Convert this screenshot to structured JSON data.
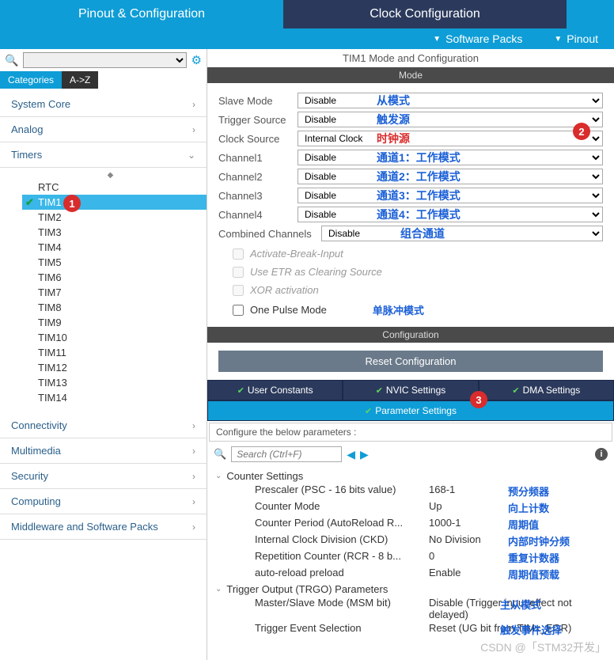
{
  "topTabs": {
    "pinout": "Pinout & Configuration",
    "clock": "Clock Configuration"
  },
  "subBar": {
    "software": "Software Packs",
    "pinout": "Pinout"
  },
  "viewTabs": {
    "categories": "Categories",
    "az": "A->Z"
  },
  "categories": {
    "systemCore": "System Core",
    "analog": "Analog",
    "timers": "Timers",
    "connectivity": "Connectivity",
    "multimedia": "Multimedia",
    "security": "Security",
    "computing": "Computing",
    "middleware": "Middleware and Software Packs"
  },
  "timerItems": [
    "RTC",
    "TIM1",
    "TIM2",
    "TIM3",
    "TIM4",
    "TIM5",
    "TIM6",
    "TIM7",
    "TIM8",
    "TIM9",
    "TIM10",
    "TIM11",
    "TIM12",
    "TIM13",
    "TIM14"
  ],
  "panelTitle": "TIM1 Mode and Configuration",
  "sections": {
    "mode": "Mode",
    "config": "Configuration"
  },
  "mode": {
    "slaveMode": {
      "label": "Slave Mode",
      "value": "Disable",
      "annot": "从模式"
    },
    "triggerSource": {
      "label": "Trigger Source",
      "value": "Disable",
      "annot": "触发源"
    },
    "clockSource": {
      "label": "Clock Source",
      "value": "Internal Clock",
      "annot": "时钟源"
    },
    "channel1": {
      "label": "Channel1",
      "value": "Disable",
      "annot": "通道1：工作模式"
    },
    "channel2": {
      "label": "Channel2",
      "value": "Disable",
      "annot": "通道2：工作模式"
    },
    "channel3": {
      "label": "Channel3",
      "value": "Disable",
      "annot": "通道3：工作模式"
    },
    "channel4": {
      "label": "Channel4",
      "value": "Disable",
      "annot": "通道4：工作模式"
    },
    "combined": {
      "label": "Combined Channels",
      "value": "Disable",
      "annot": "组合通道"
    },
    "activateBreak": "Activate-Break-Input",
    "useETR": "Use ETR as Clearing Source",
    "xor": "XOR activation",
    "onePulse": "One Pulse Mode",
    "onePulseAnnot": "单脉冲模式"
  },
  "resetBtn": "Reset Configuration",
  "cfgTabs": {
    "userConstants": "User Constants",
    "nvic": "NVIC Settings",
    "dma": "DMA Settings",
    "param": "Parameter Settings"
  },
  "cfgDesc": "Configure the below parameters :",
  "searchPlaceholder": "Search (Ctrl+F)",
  "params": {
    "counterSettings": "Counter Settings",
    "prescaler": {
      "label": "Prescaler (PSC - 16 bits value)",
      "val": "168-1",
      "annot": "预分频器"
    },
    "counterMode": {
      "label": "Counter Mode",
      "val": "Up",
      "annot": "向上计数"
    },
    "counterPeriod": {
      "label": "Counter Period (AutoReload R...",
      "val": "1000-1",
      "annot": "周期值"
    },
    "ckd": {
      "label": "Internal Clock Division (CKD)",
      "val": "No Division",
      "annot": "内部时钟分频"
    },
    "rcr": {
      "label": "Repetition Counter (RCR - 8 b...",
      "val": "0",
      "annot": "重复计数器"
    },
    "arp": {
      "label": "auto-reload preload",
      "val": "Enable",
      "annot": "周期值预载"
    },
    "trgo": "Trigger Output (TRGO) Parameters",
    "msm": {
      "label": "Master/Slave Mode (MSM bit)",
      "val": "Disable (Trigger input effect not delayed)",
      "annot": "主从模式"
    },
    "tes": {
      "label": "Trigger Event Selection",
      "val": "Reset (UG bit from TIMx_EGR)",
      "annot": "触发事件选择"
    }
  },
  "badges": {
    "b1": "1",
    "b2": "2",
    "b3": "3"
  },
  "watermark": "CSDN @「STM32开发」"
}
